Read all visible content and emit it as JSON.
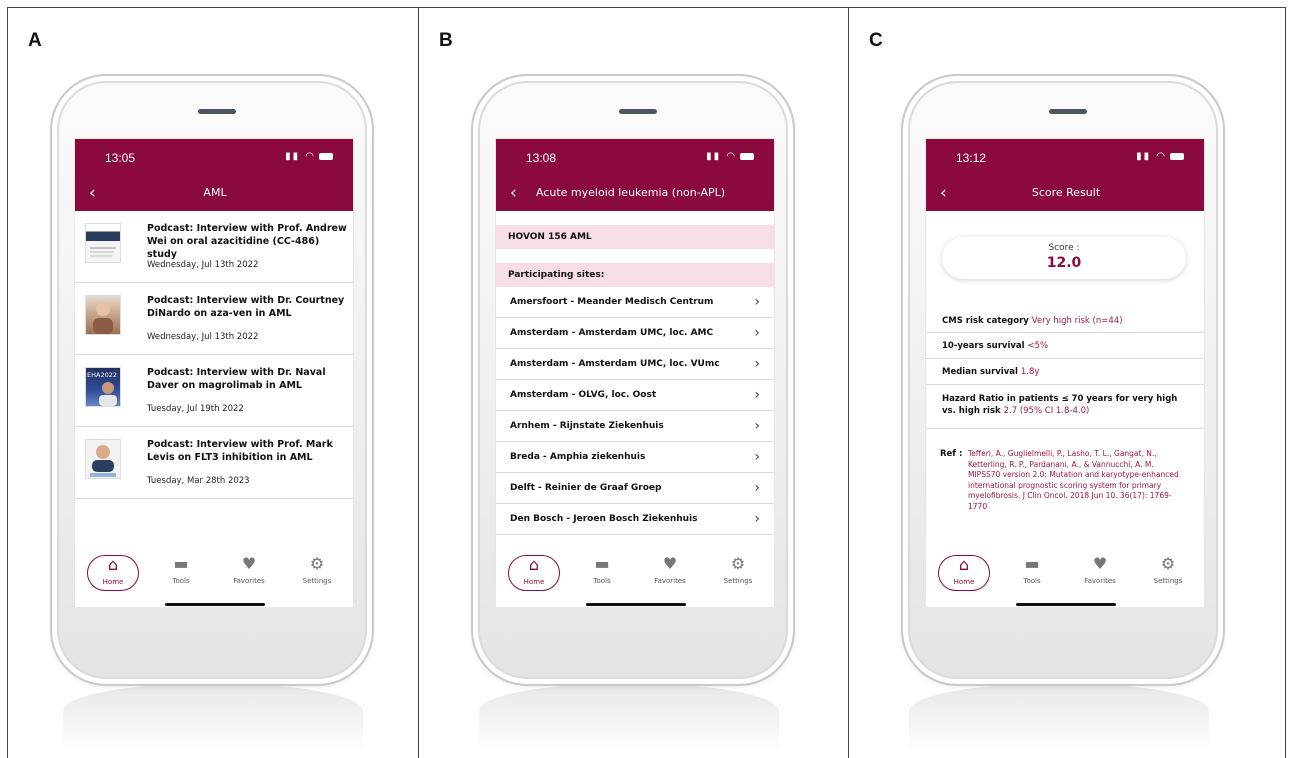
{
  "panels": [
    {
      "letter": "A"
    },
    {
      "letter": "B"
    },
    {
      "letter": "C"
    }
  ],
  "status": {
    "time_a": "13:05",
    "time_b": "13:08",
    "time_c": "13:12"
  },
  "screen_a": {
    "title": "AML",
    "items": [
      {
        "title": "Podcast: Interview with Prof. Andrew Wei on oral azacitidine (CC-486) study",
        "date": "Wednesday, Jul 13th 2022"
      },
      {
        "title": "Podcast: Interview with Dr. Courtney DiNardo on aza-ven in AML",
        "date": "Wednesday, Jul 13th 2022"
      },
      {
        "title": "Podcast: Interview with Dr. Naval Daver on magrolimab in AML",
        "date": "Tuesday, Jul 19th 2022"
      },
      {
        "title": "Podcast: Interview with Prof. Mark Levis on FLT3 inhibition in AML",
        "date": "Tuesday, Mar 28th 2023"
      }
    ],
    "thumb_badge": "EHA2022"
  },
  "screen_b": {
    "title": "Acute myeloid leukemia (non-APL)",
    "study": "HOVON 156 AML",
    "sites_header": "Participating sites:",
    "sites": [
      "Amersfoort - Meander Medisch Centrum",
      "Amsterdam - Amsterdam UMC, loc. AMC",
      "Amsterdam - Amsterdam UMC, loc. VUmc",
      "Amsterdam - OLVG, loc. Oost",
      "Arnhem - Rijnstate Ziekenhuis",
      "Breda - Amphia ziekenhuis",
      "Delft - Reinier de Graaf Groep",
      "Den Bosch - Jeroen Bosch Ziekenhuis"
    ]
  },
  "screen_c": {
    "title": "Score Result",
    "score_label": "Score :",
    "score_value": "12.0",
    "rows": [
      {
        "label": "CMS risk category",
        "value": "Very high risk (n=44)"
      },
      {
        "label": "10-years survival",
        "value": "<5%"
      },
      {
        "label": "Median survival",
        "value": "1.8y"
      },
      {
        "label": "Hazard Ratio in patients ≤ 70 years for very high vs. high risk",
        "value": "2.7 (95% CI 1.8-4.0)"
      }
    ],
    "ref_label": "Ref :",
    "ref_text": "Tefferi, A., Guglielmelli, P., Lasho, T. L., Gangat, N., Ketterling, R. P., Pardanani, A., & Vannucchi, A. M. MIPSS70 version 2.0: Mutation and karyotype-enhanced international prognostic scoring system for primary myelofibrosis. J Clin Oncol. 2018 Jun 10. 36(17): 1769-1770"
  },
  "tabbar": {
    "home": "Home",
    "tools": "Tools",
    "favorites": "Favorites",
    "settings": "Settings"
  },
  "colors": {
    "brand": "#8a0a3e",
    "band": "#f6dde6",
    "value_text": "#a0134e"
  }
}
